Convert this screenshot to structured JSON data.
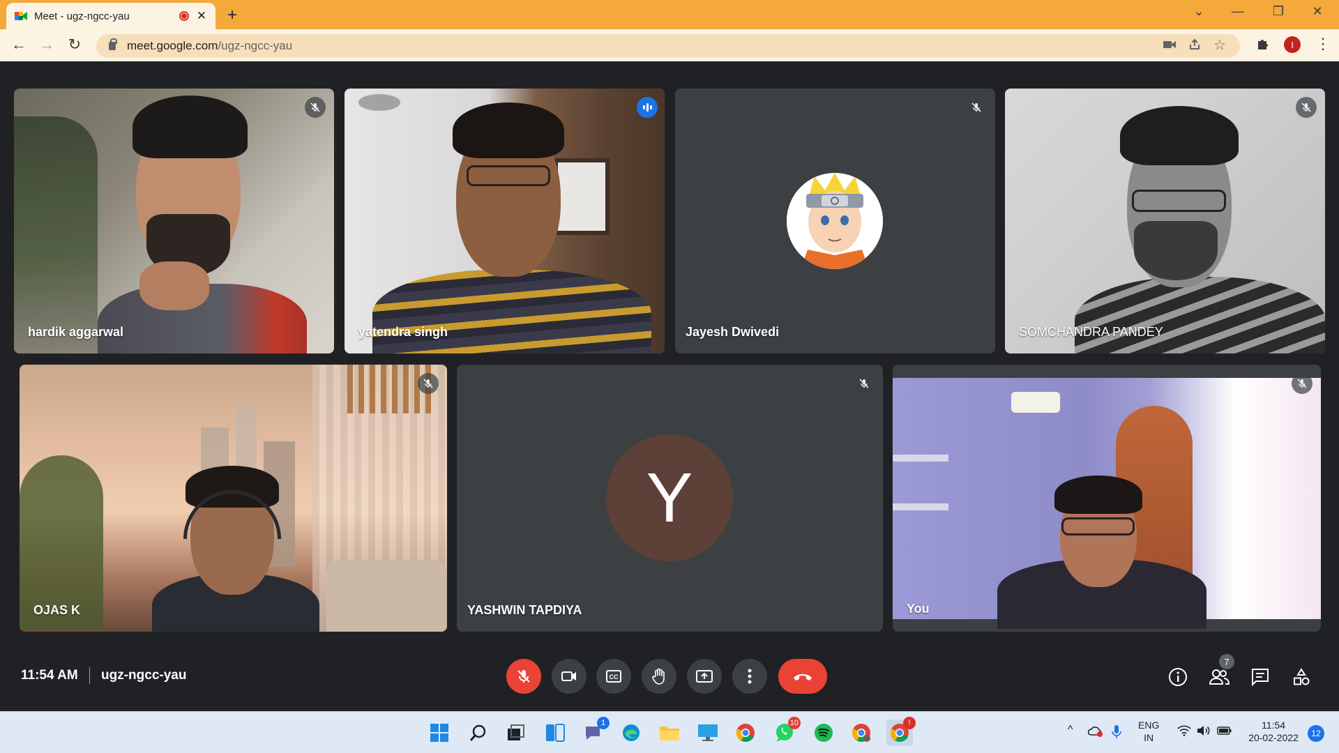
{
  "browser": {
    "tab_title": "Meet - ugz-ngcc-yau",
    "new_tab_glyph": "+",
    "url_host": "meet.google.com",
    "url_path": "/ugz-ngcc-yau",
    "profile_initial": "I",
    "window_controls": {
      "dropdown": "⌄",
      "minimize": "—",
      "restore": "❐",
      "close": "✕"
    },
    "nav": {
      "back": "←",
      "forward": "→",
      "reload": "↻"
    },
    "toolbar_icons": {
      "camera": "camera-icon",
      "share": "share-icon",
      "bookmark": "☆",
      "menu": "⋮"
    }
  },
  "participants": [
    {
      "name": "hardik aggarwal",
      "muted": true,
      "type": "video"
    },
    {
      "name": "yatendra singh",
      "muted": false,
      "speaking": true,
      "type": "video"
    },
    {
      "name": "Jayesh Dwivedi",
      "muted": true,
      "type": "avatar-image"
    },
    {
      "name": "SOMCHANDRA PANDEY",
      "muted": true,
      "type": "video"
    },
    {
      "name": "OJAS K",
      "muted": true,
      "type": "video"
    },
    {
      "name": "YASHWIN TAPDIYA",
      "muted": true,
      "type": "avatar-letter",
      "initial": "Y"
    },
    {
      "name": "You",
      "muted": true,
      "type": "video"
    }
  ],
  "meeting": {
    "time": "11:54 AM",
    "code": "ugz-ngcc-yau",
    "people_count": "7"
  },
  "controls": [
    "mic-off",
    "camera",
    "captions",
    "raise-hand",
    "present",
    "more",
    "end-call"
  ],
  "right_controls": [
    "info",
    "people",
    "chat",
    "activities"
  ],
  "taskbar": {
    "apps": [
      "windows-start",
      "search",
      "task-view",
      "widgets",
      "teams-chat",
      "edge",
      "file-explorer",
      "this-pc",
      "chrome",
      "whatsapp",
      "spotify",
      "chrome-profile",
      "chrome-active"
    ],
    "badges": {
      "teams-chat": "1",
      "whatsapp": "10",
      "chrome-active": "!"
    },
    "lang_line1": "ENG",
    "lang_line2": "IN",
    "clock_time": "11:54",
    "clock_date": "20-02-2022",
    "notifications": "12",
    "tray_chevron": "^"
  },
  "colors": {
    "tab_strip": "#f4a93a",
    "toolbar": "#fdf3e3",
    "meet_bg": "#202124",
    "tile_bg": "#3c4043",
    "speaking_outline": "#5c9cf6",
    "end_call": "#ea4335",
    "taskbar": "#dfe9f5"
  }
}
